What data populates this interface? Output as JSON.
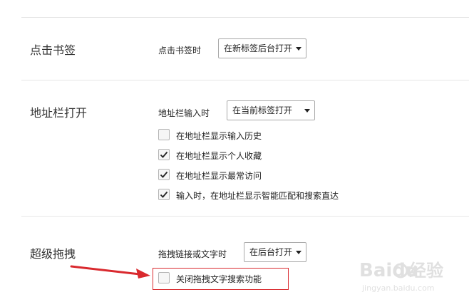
{
  "bookmark": {
    "title": "点击书签",
    "label": "点击书签时",
    "select_value": "在新标签后台打开"
  },
  "addressbar": {
    "title": "地址栏打开",
    "label": "地址栏输入时",
    "select_value": "在当前标签打开",
    "options": [
      {
        "label": "在地址栏显示输入历史",
        "checked": false
      },
      {
        "label": "在地址栏显示个人收藏",
        "checked": true
      },
      {
        "label": "在地址栏显示最常访问",
        "checked": true
      },
      {
        "label": "输入时，在地址栏显示智能匹配和搜索直达",
        "checked": true
      }
    ]
  },
  "superdrag": {
    "title": "超级拖拽",
    "label": "拖拽链接或文字时",
    "select_value": "在后台打开",
    "option": {
      "label": "关闭拖拽文字搜索功能",
      "checked": false
    }
  },
  "watermark": {
    "brand": "Baidu",
    "suffix": "经验",
    "url": "jingyan.baidu.com"
  },
  "colors": {
    "annotation_red": "#d9292e",
    "check_mark": "#222222"
  }
}
